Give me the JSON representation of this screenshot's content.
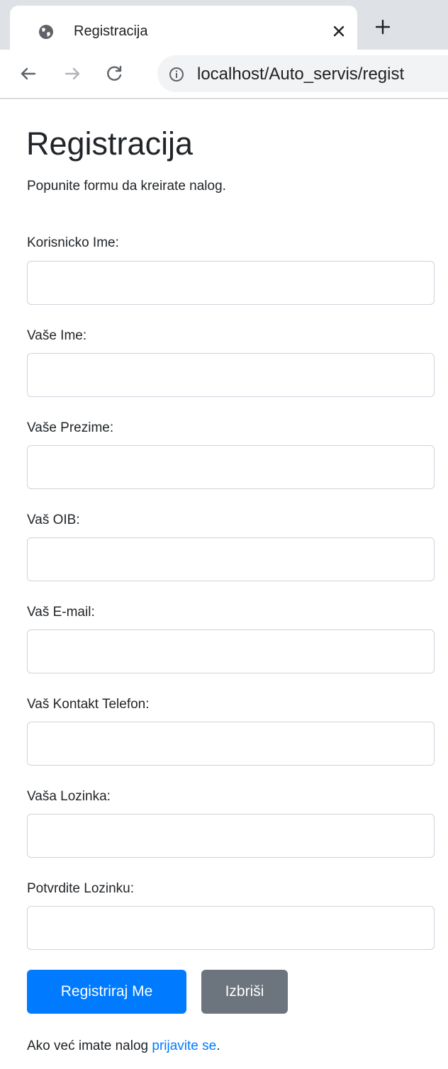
{
  "browser": {
    "tab_title": "Registracija",
    "close_symbol": "×",
    "new_tab_symbol": "+",
    "url": "localhost/Auto_servis/regist"
  },
  "icons": {
    "favicon": "globe-icon",
    "close": "close-icon",
    "new_tab": "plus-icon",
    "back": "arrow-left-icon",
    "forward": "arrow-right-icon",
    "reload": "reload-icon",
    "info": "info-icon"
  },
  "page": {
    "title": "Registracija",
    "subtitle": "Popunite formu da kreirate nalog."
  },
  "form": {
    "fields": [
      {
        "label": "Korisnicko Ime:",
        "value": "",
        "placeholder": ""
      },
      {
        "label": "Vaše Ime:",
        "value": "",
        "placeholder": ""
      },
      {
        "label": "Vaše Prezime:",
        "value": "",
        "placeholder": ""
      },
      {
        "label": "Vaš OIB:",
        "value": "",
        "placeholder": ""
      },
      {
        "label": "Vaš E-mail:",
        "value": "",
        "placeholder": ""
      },
      {
        "label": "Vaš Kontakt Telefon:",
        "value": "",
        "placeholder": ""
      },
      {
        "label": "Vaša Lozinka:",
        "value": "",
        "placeholder": ""
      },
      {
        "label": "Potvrdite Lozinku:",
        "value": "",
        "placeholder": ""
      }
    ],
    "submit_label": "Registriraj Me",
    "reset_label": "Izbriši"
  },
  "footer": {
    "text": "Ako već imate nalog ",
    "link_text": "prijavite se",
    "end": "."
  },
  "colors": {
    "primary": "#007bff",
    "secondary": "#6c757d",
    "link": "#007bff",
    "input_border": "#ced4da",
    "tabstrip": "#dee1e6",
    "omnibox": "#f1f3f4"
  }
}
